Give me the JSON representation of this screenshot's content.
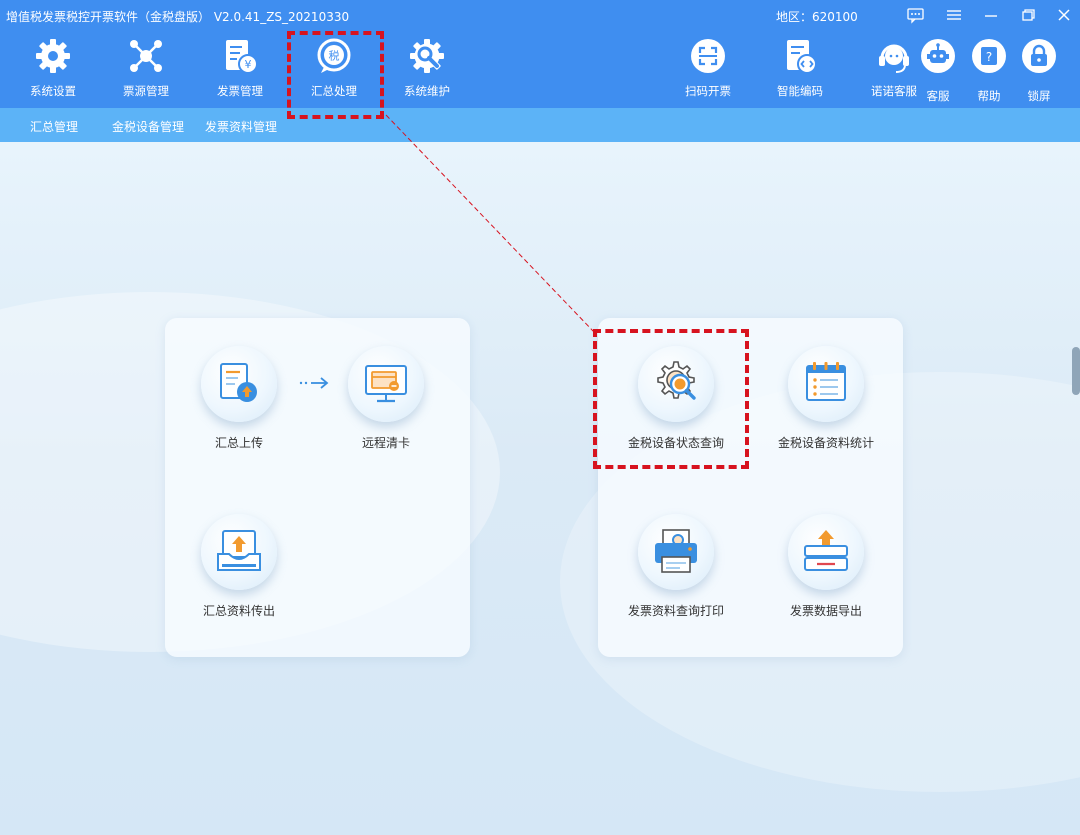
{
  "window": {
    "title": "增值税发票税控开票软件（金税盘版） V2.0.41_ZS_20210330",
    "region": "地区：620100"
  },
  "toolbar": {
    "items": [
      {
        "label": "系统设置",
        "icon": "gear-icon"
      },
      {
        "label": "票源管理",
        "icon": "network-icon"
      },
      {
        "label": "发票管理",
        "icon": "invoice-icon"
      },
      {
        "label": "汇总处理",
        "icon": "tax-summary-icon",
        "icon_text": "税",
        "highlighted": true
      },
      {
        "label": "系统维护",
        "icon": "wrench-gear-icon"
      }
    ],
    "right_items": [
      {
        "label": "扫码开票",
        "icon": "scan-icon"
      },
      {
        "label": "智能编码",
        "icon": "code-doc-icon"
      },
      {
        "label": "诺诺客服",
        "icon": "headset-icon"
      },
      {
        "label": "客服",
        "icon": "robot-icon"
      },
      {
        "label": "帮助",
        "icon": "help-icon",
        "icon_text": "?"
      },
      {
        "label": "锁屏",
        "icon": "lock-icon"
      }
    ]
  },
  "subtabs": [
    "汇总管理",
    "金税设备管理",
    "发票资料管理"
  ],
  "left_panel": {
    "items": [
      {
        "label": "汇总上传",
        "icon": "summary-upload-icon"
      },
      {
        "label": "远程清卡",
        "icon": "remote-clear-icon"
      },
      {
        "label": "汇总资料传出",
        "icon": "data-export-tray-icon"
      }
    ],
    "arrow": "→"
  },
  "right_panel": {
    "items": [
      {
        "label": "金税设备状态查询",
        "icon": "gear-search-icon",
        "highlighted": true
      },
      {
        "label": "金税设备资料统计",
        "icon": "calendar-list-icon"
      },
      {
        "label": "发票资料查询打印",
        "icon": "printer-search-icon"
      },
      {
        "label": "发票数据导出",
        "icon": "data-export-icon"
      }
    ]
  },
  "colors": {
    "toolbar": "#3f8ef0",
    "subtabs": "#5cb3f7",
    "highlight": "#d7131f",
    "icon_blue": "#3a8fe0",
    "icon_orange": "#f29a2e"
  }
}
